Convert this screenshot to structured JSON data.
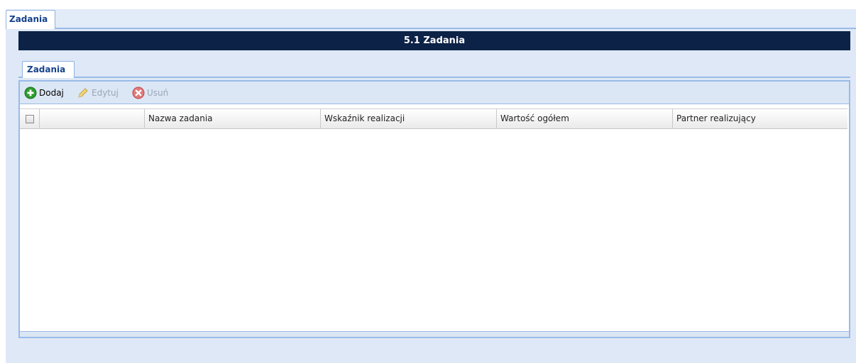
{
  "top_tabs": [
    {
      "label": "Zadania"
    }
  ],
  "section": {
    "title": "5.1 Zadania"
  },
  "inner_tabs": [
    {
      "label": "Zadania"
    }
  ],
  "toolbar": {
    "add_label": "Dodaj",
    "edit_label": "Edytuj",
    "delete_label": "Usuń",
    "add_icon": "plus-circle-icon",
    "edit_icon": "pencil-icon",
    "delete_icon": "x-circle-icon"
  },
  "grid": {
    "columns": [
      "Nazwa zadania",
      "Wskaźnik realizacji",
      "Wartość ogółem",
      "Partner realizujący"
    ],
    "rows": []
  },
  "colors": {
    "header_bar": "#0c2247",
    "tab_text": "#15428b",
    "panel_bg": "#dfe8f6",
    "border": "#99bbe8",
    "add_icon": "#2e9e2e",
    "delete_icon": "#d23b3b"
  }
}
